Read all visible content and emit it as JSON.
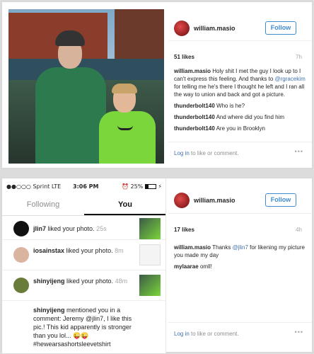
{
  "post1": {
    "username": "william.masio",
    "follow_label": "Follow",
    "likes": "51 likes",
    "time": "7h",
    "comments": [
      {
        "user": "william.masio",
        "text_before": "Holy shit I met the guy I look up to I can't express this feeling. And thanks to ",
        "mention": "@rgracekim",
        "text_after": " for telling me he's there I thought he left and I ran all the way to union and back and got a picture."
      },
      {
        "user": "thunderbolt140",
        "text": "Who is he?"
      },
      {
        "user": "thunderbolt140",
        "text": "And where did you find him"
      },
      {
        "user": "thunderbolt140",
        "text": "Are you in Brooklyn"
      }
    ],
    "login_link": "Log in",
    "login_rest": " to like or comment.",
    "more": "•••"
  },
  "phone": {
    "carrier": "●●○○○ Sprint  LTE",
    "clock": "3:06 PM",
    "battery": "⏰ 25%",
    "tab_following": "Following",
    "tab_you": "You",
    "notifications": [
      {
        "user": "jlin7",
        "text": " liked your photo.",
        "time": " 25s"
      },
      {
        "user": "iosainstax",
        "text": " liked your photo.",
        "time": " 8m"
      },
      {
        "user": "shinyijeng",
        "text": " liked your photo.",
        "time": " 48m"
      },
      {
        "user": "shinyijeng",
        "text": " mentioned you in a comment: Jeremy @jlin7, I like this pic.! This kid apparently is stronger than you lol... 😜😜 #hewearsashortsleevetshirt",
        "time": ""
      }
    ]
  },
  "post2": {
    "username": "william.masio",
    "follow_label": "Follow",
    "likes": "17 likes",
    "time": "4h",
    "comments": [
      {
        "user": "william.masio",
        "text_before": "Thanks ",
        "mention": "@jlin7",
        "text_after": " for likening my picture you made my day"
      },
      {
        "user": "mylaarae",
        "text": "omll!"
      }
    ],
    "login_link": "Log in",
    "login_rest": " to like or comment.",
    "more": "•••"
  }
}
